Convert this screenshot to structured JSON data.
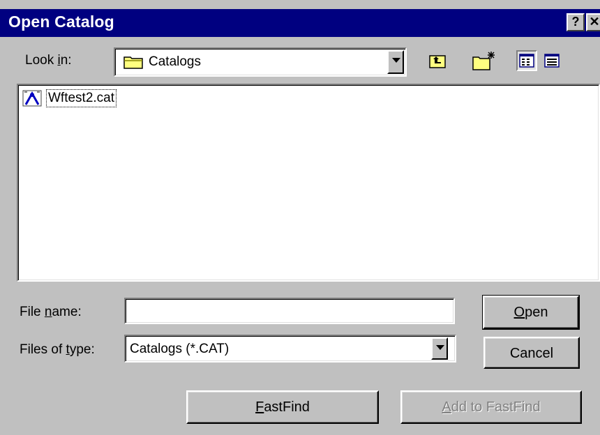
{
  "dialog": {
    "title": "Open Catalog",
    "help_button": "?",
    "close_button": "✕"
  },
  "look_in": {
    "label_pre": "Look ",
    "label_accel": "i",
    "label_post": "n:",
    "value": "Catalogs"
  },
  "toolbar": {
    "up_folder": "up-one-level",
    "new_folder": "create-new-folder",
    "list_view": "list-view",
    "details_view": "details-view"
  },
  "files": [
    {
      "name": "Wftest2.cat",
      "icon": "catalog-file-icon"
    }
  ],
  "file_name": {
    "label_pre": "File ",
    "label_accel": "n",
    "label_post": "ame:",
    "value": ""
  },
  "file_type": {
    "label_pre": "Files of ",
    "label_accel": "t",
    "label_post": "ype:",
    "value": "Catalogs (*.CAT)"
  },
  "buttons": {
    "open_accel": "O",
    "open_rest": "pen",
    "cancel": "Cancel",
    "fastfind_accel": "F",
    "fastfind_rest": "astFind",
    "add_fastfind_pre": "",
    "add_fastfind_accel": "A",
    "add_fastfind_rest": "dd to FastFind"
  },
  "colors": {
    "titlebar": "#000080",
    "face": "#c0c0c0"
  }
}
